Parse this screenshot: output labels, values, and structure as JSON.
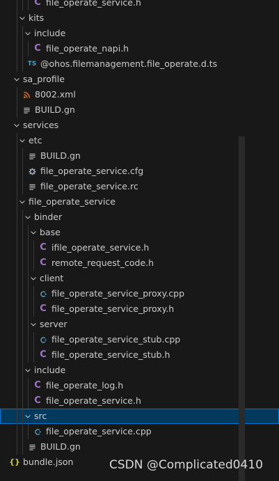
{
  "explorer": {
    "items": [
      {
        "label": "file_operate_service.h",
        "depth": 3,
        "kind": "c"
      },
      {
        "label": "kits",
        "depth": 1,
        "kind": "folder"
      },
      {
        "label": "include",
        "depth": 2,
        "kind": "folder"
      },
      {
        "label": "file_operate_napi.h",
        "depth": 3,
        "kind": "c"
      },
      {
        "label": "@ohos.filemanagement.file_operate.d.ts",
        "depth": 2,
        "kind": "ts"
      },
      {
        "label": "sa_profile",
        "depth": 0,
        "kind": "folder"
      },
      {
        "label": "8002.xml",
        "depth": 1,
        "kind": "xml"
      },
      {
        "label": "BUILD.gn",
        "depth": 1,
        "kind": "gn"
      },
      {
        "label": "services",
        "depth": 0,
        "kind": "folder"
      },
      {
        "label": "etc",
        "depth": 1,
        "kind": "folder"
      },
      {
        "label": "BUILD.gn",
        "depth": 2,
        "kind": "gn"
      },
      {
        "label": "file_operate_service.cfg",
        "depth": 2,
        "kind": "cfg"
      },
      {
        "label": "file_operate_service.rc",
        "depth": 2,
        "kind": "gn"
      },
      {
        "label": "file_operate_service",
        "depth": 1,
        "kind": "folder"
      },
      {
        "label": "binder",
        "depth": 2,
        "kind": "folder"
      },
      {
        "label": "base",
        "depth": 3,
        "kind": "folder"
      },
      {
        "label": "ifile_operate_service.h",
        "depth": 4,
        "kind": "c"
      },
      {
        "label": "remote_request_code.h",
        "depth": 4,
        "kind": "c"
      },
      {
        "label": "client",
        "depth": 3,
        "kind": "folder"
      },
      {
        "label": "file_operate_service_proxy.cpp",
        "depth": 4,
        "kind": "cpp"
      },
      {
        "label": "file_operate_service_proxy.h",
        "depth": 4,
        "kind": "c"
      },
      {
        "label": "server",
        "depth": 3,
        "kind": "folder"
      },
      {
        "label": "file_operate_service_stub.cpp",
        "depth": 4,
        "kind": "cpp"
      },
      {
        "label": "file_operate_service_stub.h",
        "depth": 4,
        "kind": "c"
      },
      {
        "label": "include",
        "depth": 2,
        "kind": "folder"
      },
      {
        "label": "file_operate_log.h",
        "depth": 3,
        "kind": "c"
      },
      {
        "label": "file_operate_service.h",
        "depth": 3,
        "kind": "c"
      },
      {
        "label": "src",
        "depth": 2,
        "kind": "folder",
        "selected": true
      },
      {
        "label": "file_operate_service.cpp",
        "depth": 3,
        "kind": "cpp"
      },
      {
        "label": "BUILD.gn",
        "depth": 2,
        "kind": "gn"
      },
      {
        "label": "bundle.json",
        "depth": 0,
        "kind": "json"
      }
    ]
  },
  "icons": {
    "c": {
      "name": "c-file-icon",
      "glyph": "C",
      "color": "#a074c4"
    },
    "cpp": {
      "name": "cpp-file-icon",
      "color": "#519aba"
    },
    "ts": {
      "name": "typescript-file-icon",
      "glyph": "TS",
      "color": "#519aba"
    },
    "xml": {
      "name": "rss-xml-icon",
      "color": "#e37933"
    },
    "gn": {
      "name": "text-lines-icon",
      "color": "#c5c5c5"
    },
    "cfg": {
      "name": "gear-icon",
      "color": "#9da5b4"
    },
    "json": {
      "name": "json-braces-icon",
      "glyph": "{}",
      "color": "#cbcb41"
    },
    "folder": {
      "name": "chevron-down-icon",
      "color": "#c5c5c5"
    }
  },
  "watermark": "CSDN @Complicated0410"
}
